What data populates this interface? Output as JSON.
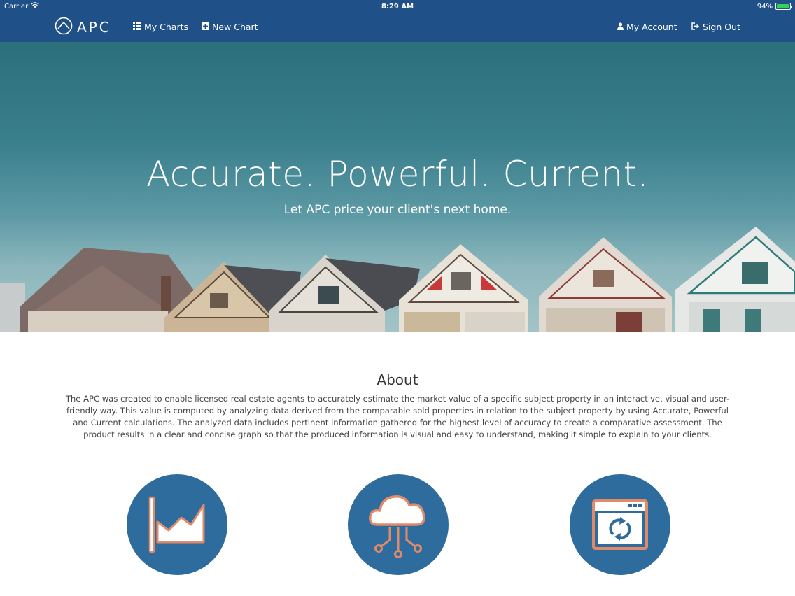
{
  "status_bar": {
    "carrier": "Carrier",
    "time": "8:29 AM",
    "battery": "94%",
    "battery_level": 0.94
  },
  "navbar": {
    "brand": "APC",
    "links": {
      "my_charts": "My Charts",
      "new_chart": "New Chart",
      "my_account": "My Account",
      "sign_out": "Sign Out"
    }
  },
  "hero": {
    "title": "Accurate. Powerful. Current.",
    "subtitle": "Let APC price your client's next home."
  },
  "about": {
    "title": "About",
    "text": "The APC was created to enable licensed real estate agents to accurately estimate the market value of a specific subject property in an interactive, visual and user-friendly way. This value is computed by analyzing data derived from the comparable sold properties in relation to the subject property by using Accurate, Powerful and Current calculations. The analyzed data includes pertinent information gathered for the highest level of accuracy to create a comparative assessment. The product results in a clear and concise graph so that the produced information is visual and easy to understand, making it simple to explain to your clients."
  },
  "features": [
    {
      "icon": "area-chart-icon"
    },
    {
      "icon": "cloud-network-icon"
    },
    {
      "icon": "browser-refresh-icon"
    }
  ],
  "colors": {
    "nav_bg": "#205088",
    "feature_circle": "#2e6c9e",
    "icon_accent": "#e08a6a",
    "battery": "#34d058"
  }
}
